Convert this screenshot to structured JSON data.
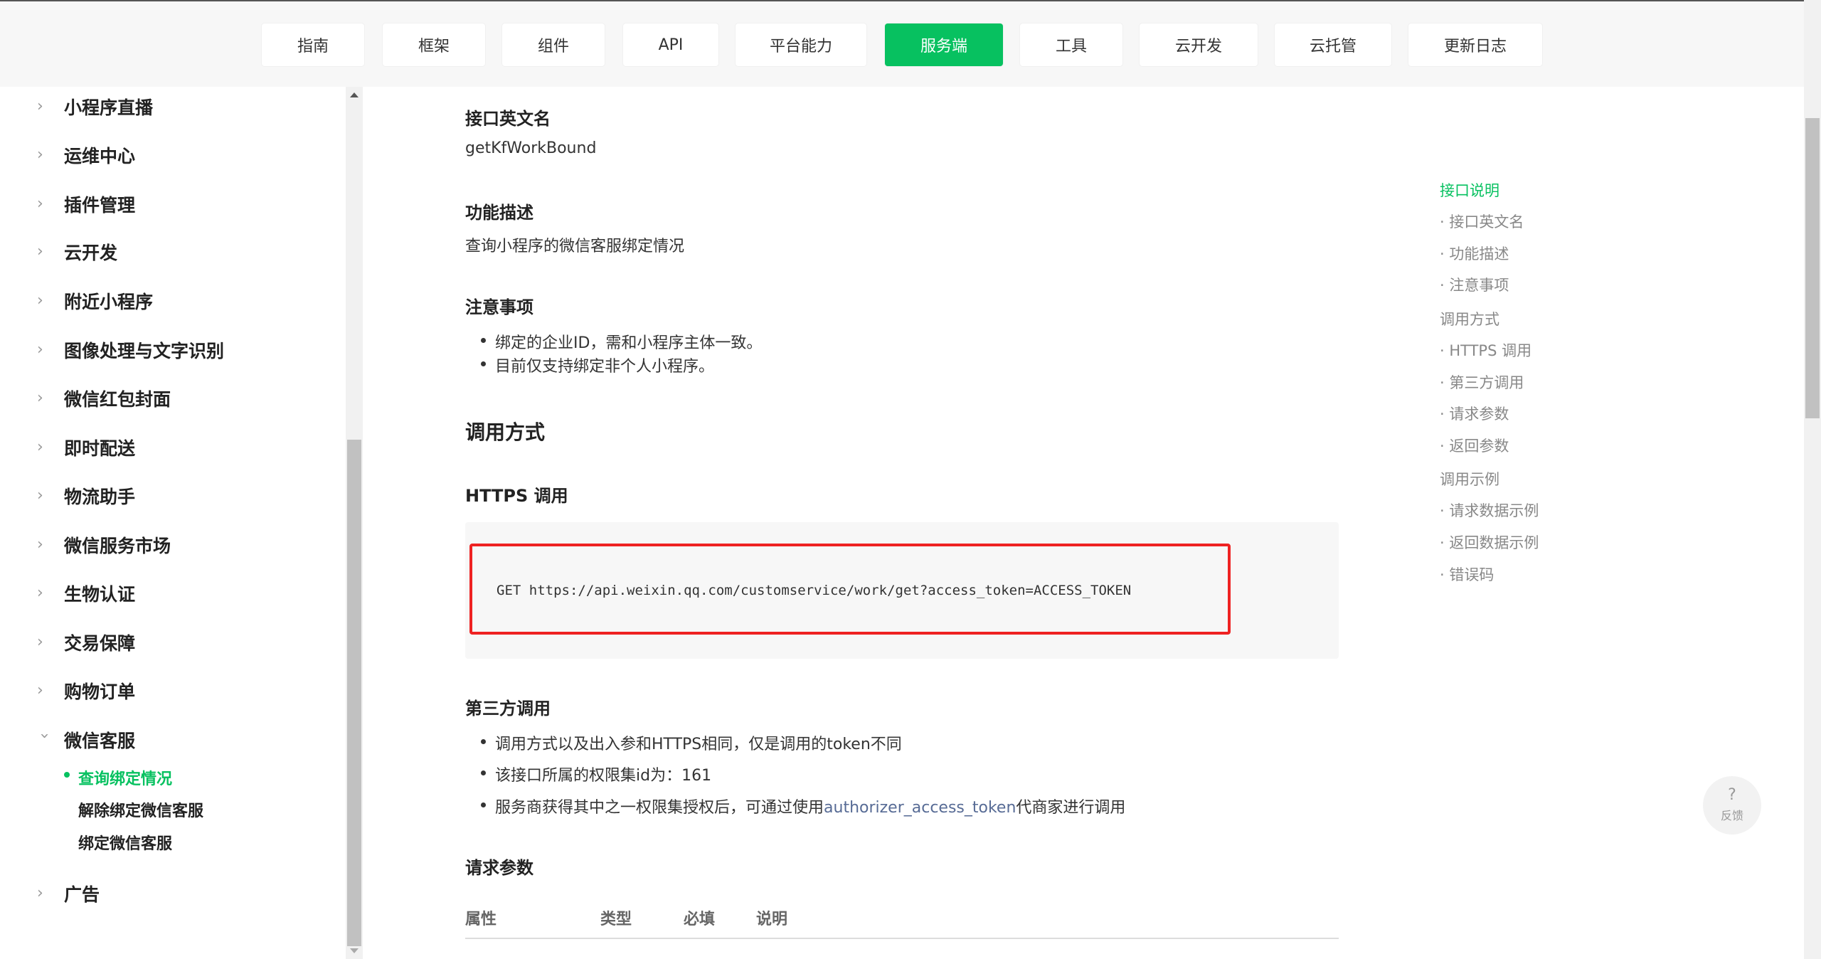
{
  "nav": {
    "items": [
      {
        "label": "指南",
        "active": false
      },
      {
        "label": "框架",
        "active": false
      },
      {
        "label": "组件",
        "active": false
      },
      {
        "label": "API",
        "active": false
      },
      {
        "label": "平台能力",
        "active": false
      },
      {
        "label": "服务端",
        "active": true
      },
      {
        "label": "工具",
        "active": false
      },
      {
        "label": "云开发",
        "active": false
      },
      {
        "label": "云托管",
        "active": false
      },
      {
        "label": "更新日志",
        "active": false
      }
    ]
  },
  "sidebar": {
    "items": [
      {
        "label": "小程序直播",
        "expanded": false
      },
      {
        "label": "运维中心",
        "expanded": false
      },
      {
        "label": "插件管理",
        "expanded": false
      },
      {
        "label": "云开发",
        "expanded": false
      },
      {
        "label": "附近小程序",
        "expanded": false
      },
      {
        "label": "图像处理与文字识别",
        "expanded": false
      },
      {
        "label": "微信红包封面",
        "expanded": false
      },
      {
        "label": "即时配送",
        "expanded": false
      },
      {
        "label": "物流助手",
        "expanded": false
      },
      {
        "label": "微信服务市场",
        "expanded": false
      },
      {
        "label": "生物认证",
        "expanded": false
      },
      {
        "label": "交易保障",
        "expanded": false
      },
      {
        "label": "购物订单",
        "expanded": false
      },
      {
        "label": "微信客服",
        "expanded": true
      },
      {
        "label": "广告",
        "expanded": false
      }
    ],
    "subitems": [
      {
        "label": "查询绑定情况",
        "active": true
      },
      {
        "label": "解除绑定微信客服",
        "active": false
      },
      {
        "label": "绑定微信客服",
        "active": false
      }
    ]
  },
  "content": {
    "english_name_heading": "接口英文名",
    "english_name": "getKfWorkBound",
    "desc_heading": "功能描述",
    "desc": "查询小程序的微信客服绑定情况",
    "notes_heading": "注意事项",
    "notes": [
      "绑定的企业ID，需和小程序主体一致。",
      "目前仅支持绑定非个人小程序。"
    ],
    "call_heading": "调用方式",
    "https_heading": "HTTPS 调用",
    "https_code": "GET https://api.weixin.qq.com/customservice/work/get?access_token=ACCESS_TOKEN",
    "third_heading": "第三方调用",
    "third_bullets": {
      "b1": "调用方式以及出入参和HTTPS相同，仅是调用的token不同",
      "b2": "该接口所属的权限集id为：161",
      "b3_prefix": "服务商获得其中之一权限集授权后，可通过使用",
      "b3_link": "authorizer_access_token",
      "b3_suffix": "代商家进行调用"
    },
    "params_heading": "请求参数",
    "table_headers": [
      "属性",
      "类型",
      "必填",
      "说明"
    ]
  },
  "toc": {
    "items": [
      {
        "label": "接口说明",
        "sub": false,
        "active": true
      },
      {
        "label": "接口英文名",
        "sub": true,
        "active": false
      },
      {
        "label": "功能描述",
        "sub": true,
        "active": false
      },
      {
        "label": "注意事项",
        "sub": true,
        "active": false
      },
      {
        "label": "调用方式",
        "sub": false,
        "active": false
      },
      {
        "label": "HTTPS 调用",
        "sub": true,
        "active": false
      },
      {
        "label": "第三方调用",
        "sub": true,
        "active": false
      },
      {
        "label": "请求参数",
        "sub": true,
        "active": false
      },
      {
        "label": "返回参数",
        "sub": true,
        "active": false
      },
      {
        "label": "调用示例",
        "sub": false,
        "active": false
      },
      {
        "label": "请求数据示例",
        "sub": true,
        "active": false
      },
      {
        "label": "返回数据示例",
        "sub": true,
        "active": false
      },
      {
        "label": "错误码",
        "sub": true,
        "active": false
      }
    ]
  },
  "feedback": {
    "icon": "?",
    "label": "反馈"
  },
  "colors": {
    "accent": "#07c160",
    "highlight": "#ee2222",
    "link": "#576b95"
  }
}
